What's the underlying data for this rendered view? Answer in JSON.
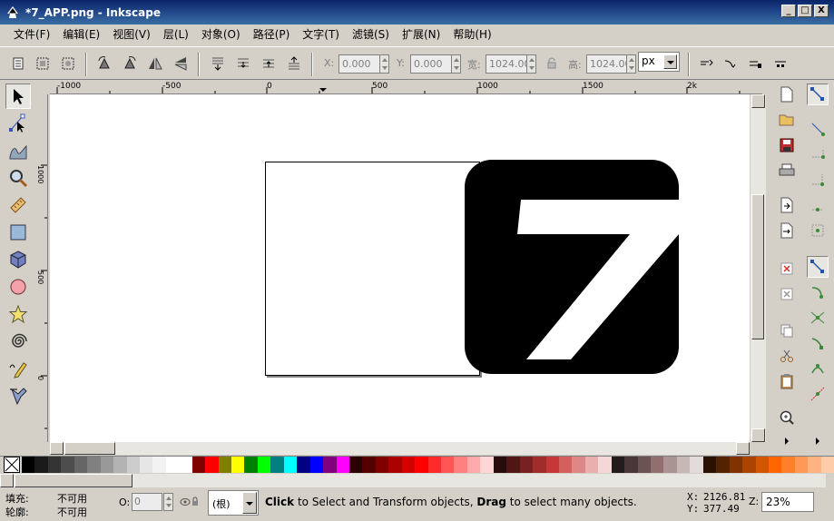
{
  "window": {
    "title": "*7_APP.png - Inkscape",
    "minimize": "_",
    "maximize": "□",
    "close": "X"
  },
  "menu": [
    "文件(F)",
    "编辑(E)",
    "视图(V)",
    "层(L)",
    "对象(O)",
    "路径(P)",
    "文字(T)",
    "滤镜(S)",
    "扩展(N)",
    "帮助(H)"
  ],
  "toolbar": {
    "x_label": "X:",
    "x_value": "0.000",
    "y_label": "Y:",
    "y_value": "0.000",
    "w_label": "宽:",
    "w_value": "1024.00",
    "h_label": "高:",
    "h_value": "1024.00",
    "unit": "px"
  },
  "ruler": {
    "h_labels": [
      "-1000",
      "-500",
      "0",
      "500",
      "1000",
      "1500",
      "2k"
    ],
    "v_labels": [
      "1000",
      "500",
      "0"
    ]
  },
  "canvas": {
    "digit": "7"
  },
  "palette": {
    "colors": [
      "#000000",
      "#1a1a1a",
      "#333333",
      "#4d4d4d",
      "#666666",
      "#808080",
      "#999999",
      "#b3b3b3",
      "#cccccc",
      "#e6e6e6",
      "#f2f2f2",
      "#ffffff",
      "#ffffff",
      "#800000",
      "#ff0000",
      "#808000",
      "#ffff00",
      "#008000",
      "#00ff00",
      "#008080",
      "#00ffff",
      "#000080",
      "#0000ff",
      "#800080",
      "#ff00ff",
      "#2b0000",
      "#550000",
      "#800000",
      "#aa0000",
      "#d40000",
      "#ff0000",
      "#ff2a2a",
      "#ff5555",
      "#ff8080",
      "#ffaaaa",
      "#ffd5d5",
      "#280b0b",
      "#501616",
      "#782121",
      "#a02c2c",
      "#c83737",
      "#d35f5f",
      "#de8787",
      "#e9afaf",
      "#f4d7d7",
      "#241c1c",
      "#483737",
      "#6c5353",
      "#916f6f",
      "#ac9393",
      "#c8b7b7",
      "#e3dbdb",
      "#2b1100",
      "#552200",
      "#803300",
      "#aa4400",
      "#d45500",
      "#ff6600",
      "#ff7f2a",
      "#ff9955",
      "#ffb380",
      "#ffccaa"
    ]
  },
  "status": {
    "fill_label": "填充:",
    "fill_value": "不可用",
    "stroke_label": "轮廓:",
    "stroke_value": "不可用",
    "opacity_label": "O:",
    "opacity_value": "0",
    "layer": "(根)",
    "msg_click": "Click",
    "msg_part1": " to Select and Transform objects, ",
    "msg_drag": "Drag",
    "msg_part2": " to select many objects.",
    "cursor_x_label": "X:",
    "cursor_x": "2126.81",
    "cursor_y_label": "Y:",
    "cursor_y": "377.49",
    "zoom_label": "Z:",
    "zoom": "23%"
  }
}
